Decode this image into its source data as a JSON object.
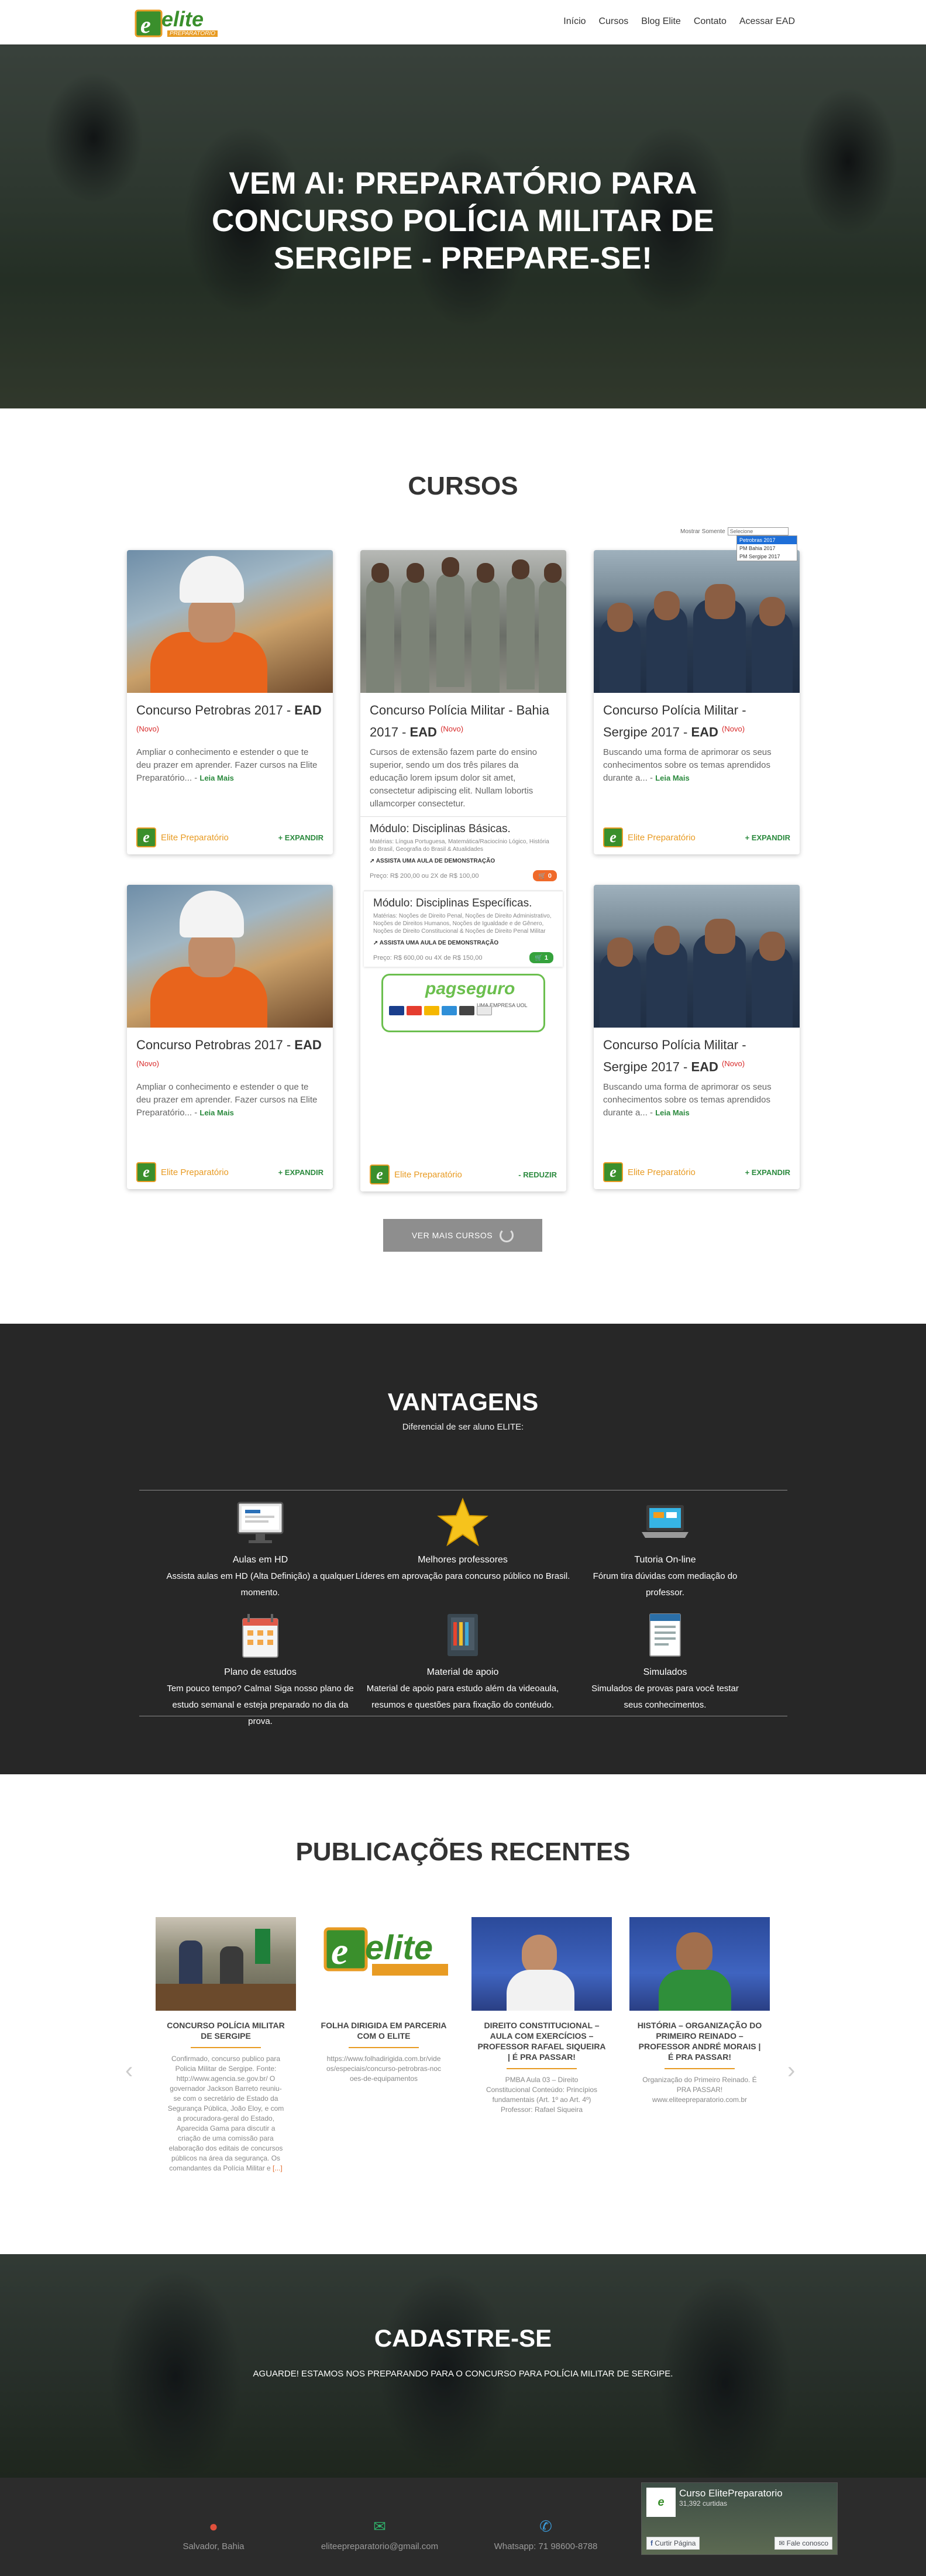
{
  "header": {
    "logo_text": "elite",
    "logo_sub": "PREPARATÓRIO",
    "nav": [
      "Início",
      "Cursos",
      "Blog Elite",
      "Contato",
      "Acessar EAD"
    ]
  },
  "hero": {
    "title_line1": "VEM AI: PREPARATÓRIO PARA",
    "title_line2": "CONCURSO POLÍCIA MILITAR DE",
    "title_line3": "SERGIPE - PREPARE-SE!"
  },
  "courses": {
    "title": "CURSOS",
    "filter_label": "Mostrar Somente",
    "filter_value": "Selecione",
    "filter_options": [
      "Petrobras 2017",
      "PM Bahia 2017",
      "PM Sergipe 2017"
    ],
    "cards": [
      {
        "title": "Concurso Petrobras 2017 - ",
        "title_bold": "EAD",
        "badge": "(Novo)",
        "desc": "Ampliar o conhecimento e estender o que te deu prazer em aprender. Fazer cursos na Elite Preparatório... - ",
        "more": "Leia Mais",
        "brand": "Elite Preparatório",
        "action": "+ EXPANDIR"
      },
      {
        "title": "Concurso Polícia Militar - Bahia 2017 - ",
        "title_bold": "EAD",
        "badge": "(Novo)",
        "desc": "Cursos de extensão fazem parte do ensino superior, sendo um dos três pilares da educação lorem ipsum dolor sit amet, consectetur adipiscing elit. Nullam lobortis ullamcorper consectetur.",
        "brand": "Elite Preparatório",
        "action": "- REDUZIR",
        "modules": [
          {
            "name": "Módulo: Disciplinas Básicas.",
            "text": "Matérias: Língua Portuguesa, Matemática/Raciocínio Lógico, História do Brasil, Geografia do Brasil & Atualidades",
            "demo": "ASSISTA UMA AULA DE DEMONSTRAÇÃO",
            "price": "Preço: R$ 200,00 ou 2X de R$ 100,00",
            "cart": "0"
          },
          {
            "name": "Módulo: Disciplinas Específicas.",
            "text": "Matérias: Noções de Direito Penal, Noções de Direito Administrativo, Noções de Direitos Humanos, Noções de Igualdade e de Gênero, Noções de Direito Constitucional & Noções de Direito Penal Militar",
            "demo": "ASSISTA UMA AULA DE DEMONSTRAÇÃO",
            "price": "Preço: R$ 600,00 ou 4X de R$ 150,00",
            "cart": "1"
          }
        ],
        "pagseguro": "pagseguro",
        "pagseguro_sub": "UMA EMPRESA UOL"
      },
      {
        "title": "Concurso Polícia Militar - Sergipe 2017 - ",
        "title_bold": "EAD",
        "badge": "(Novo)",
        "desc": "Buscando uma forma de aprimorar os seus conhecimentos sobre os temas aprendidos durante a... - ",
        "more": "Leia Mais",
        "brand": "Elite Preparatório",
        "action": "+ EXPANDIR"
      },
      {
        "title": "Concurso Petrobras 2017 - ",
        "title_bold": "EAD",
        "badge": "(Novo)",
        "desc": "Ampliar o conhecimento e estender o que te deu prazer em aprender. Fazer cursos na Elite Preparatório... - ",
        "more": "Leia Mais",
        "brand": "Elite Preparatório",
        "action": "+ EXPANDIR"
      },
      {
        "title": "Concurso Polícia Militar - Sergipe 2017 - ",
        "title_bold": "EAD",
        "badge": "(Novo)",
        "desc": "Buscando uma forma de aprimorar os seus conhecimentos sobre os temas aprendidos durante a... - ",
        "more": "Leia Mais",
        "brand": "Elite Preparatório",
        "action": "+ EXPANDIR"
      }
    ],
    "more_button": "VER MAIS CURSOS"
  },
  "advantages": {
    "title": "VANTAGENS",
    "subtitle": "Diferencial de ser aluno ELITE:",
    "items": [
      {
        "title": "Aulas em HD",
        "text": "Assista aulas em HD (Alta Definição) a qualquer momento.",
        "icon": "monitor-icon"
      },
      {
        "title": "Melhores professores",
        "text": "Líderes em aprovação para concurso público no Brasil.",
        "icon": "star-icon"
      },
      {
        "title": "Tutoria On-line",
        "text": "Fórum tira dúvidas com mediação do professor.",
        "icon": "laptop-icon"
      },
      {
        "title": "Plano de estudos",
        "text": "Tem pouco tempo? Calma! Siga nosso plano de estudo semanal e esteja preparado no dia da prova.",
        "icon": "calendar-icon"
      },
      {
        "title": "Material de apoio",
        "text": "Material de apoio para estudo além da videoaula, resumos e questões para fixação do contéudo.",
        "icon": "notebook-icon"
      },
      {
        "title": "Simulados",
        "text": "Simulados de provas para você testar seus conhecimentos.",
        "icon": "document-icon"
      }
    ]
  },
  "publications": {
    "title": "PUBLICAÇÕES RECENTES",
    "items": [
      {
        "title": "CONCURSO POLÍCIA MILITAR DE SERGIPE",
        "text": "Confirmado, concurso publico para Policia Militar de Sergipe. Fonte: http://www.agencia.se.gov.br/ O governador Jackson Barreto reuniu-se com o secretário de Estado da Segurança Pública, João Eloy, e com a procuradora-geral do Estado, Aparecida Gama para discutir a criação de uma comissão para elaboração dos editais de concursos públicos na área da segurança. Os comandantes da Polícia Militar e",
        "link": "[...]"
      },
      {
        "title": "FOLHA DIRIGIDA EM PARCERIA COM O ELITE",
        "text": "https://www.folhadirigida.com.br/videos/especiais/concurso-petrobras-nocoes-de-equipamentos",
        "link": ""
      },
      {
        "title": "DIREITO CONSTITUCIONAL – AULA COM EXERCÍCIOS – PROFESSOR RAFAEL SIQUEIRA | É PRA PASSAR!",
        "text": "PMBA Aula 03 – Direito Constitucional Conteúdo: Princípios fundamentais (Art. 1º ao Art. 4º) Professor: Rafael Siqueira",
        "link": ""
      },
      {
        "title": "HISTÓRIA – ORGANIZAÇÃO DO PRIMEIRO REINADO – PROFESSOR ANDRÉ MORAIS | É PRA PASSAR!",
        "text": "Organização do Primeiro Reinado. É PRA PASSAR! www.eliteepreparatorio.com.br",
        "link": ""
      }
    ]
  },
  "signup": {
    "title": "CADASTRE-SE",
    "subtitle": "AGUARDE! ESTAMOS NOS PREPARANDO PARA O CONCURSO PARA POLÍCIA MILITAR DE SERGIPE."
  },
  "footer": {
    "location": "Salvador, Bahia",
    "email": "eliteepreparatorio@gmail.com",
    "whatsapp": "Whatsapp: 71 98600-8788",
    "fb_name": "Curso ElitePreparatorio",
    "fb_likes": "31,392 curtidas",
    "fb_like_btn": "Curtir Página",
    "fb_contact_btn": "Fale conosco"
  },
  "colors": {
    "brand_green": "#3a8f2c",
    "brand_orange": "#e89b23",
    "badge_red": "#d82b2b",
    "dark_section": "#272727"
  }
}
